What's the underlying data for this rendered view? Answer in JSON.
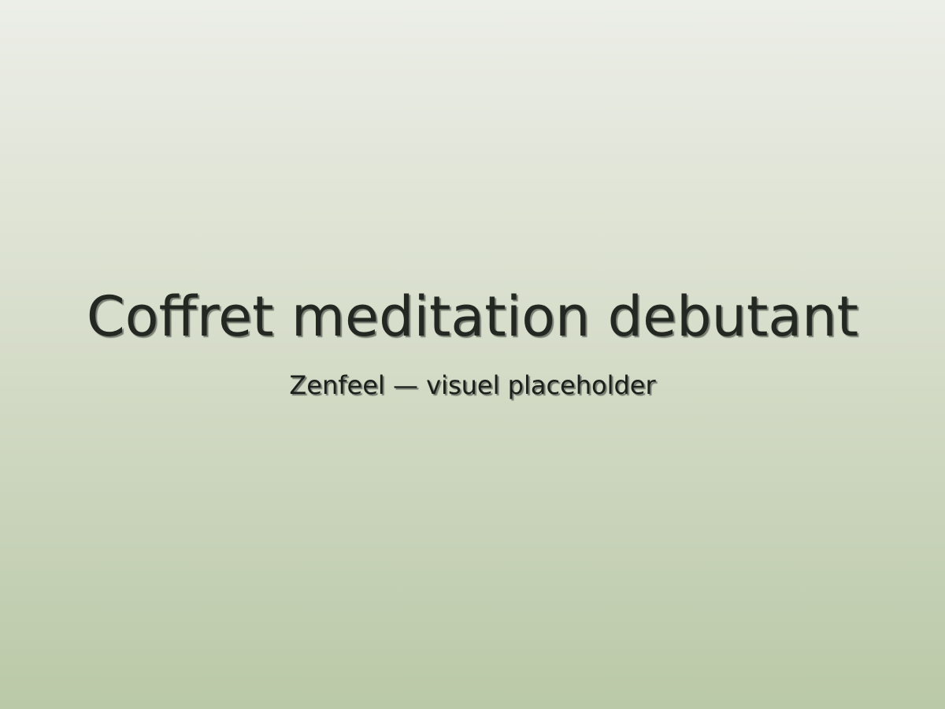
{
  "placeholder": {
    "title": "Coffret meditation debutant",
    "subtitle": "Zenfeel — visuel placeholder"
  },
  "colors": {
    "background_top": "#eceee8",
    "background_bottom": "#bac9a7",
    "text": "#232823"
  }
}
